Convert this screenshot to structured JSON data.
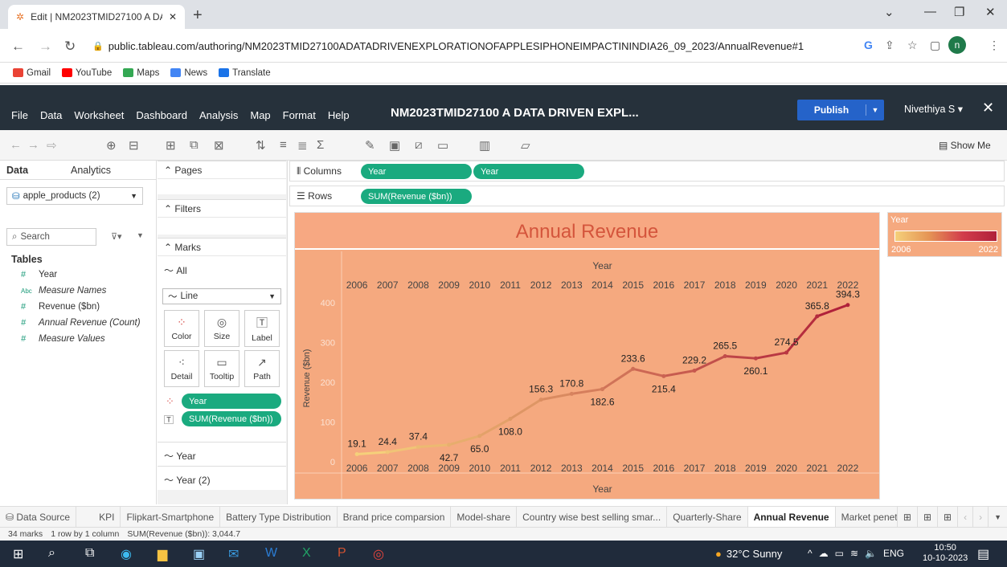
{
  "browser": {
    "tab_title": "Edit | NM2023TMID27100 A DAT",
    "url": "public.tableau.com/authoring/NM2023TMID27100ADATADRIVENEXPLORATIONOFAPPLESIPHONEIMPACTININDIA26_09_2023/AnnualRevenue#1",
    "profile_initial": "n",
    "bookmarks": [
      "Gmail",
      "YouTube",
      "Maps",
      "News",
      "Translate"
    ]
  },
  "tableau": {
    "menus": [
      "File",
      "Data",
      "Worksheet",
      "Dashboard",
      "Analysis",
      "Map",
      "Format",
      "Help"
    ],
    "workbook_title": "NM2023TMID27100 A DATA DRIVEN EXPL...",
    "publish_label": "Publish",
    "user_name": "Nivethiya S ▾",
    "show_me": "Show Me"
  },
  "data_pane": {
    "tabs": [
      "Data",
      "Analytics"
    ],
    "datasource": "apple_products (2)",
    "search_placeholder": "Search",
    "tables_header": "Tables",
    "fields": [
      {
        "icon": "#",
        "name": "Year"
      },
      {
        "icon": "Abc",
        "name": "Measure Names"
      },
      {
        "icon": "#",
        "name": "Revenue ($bn)"
      },
      {
        "icon": "#",
        "name": "Annual Revenue (Count)"
      },
      {
        "icon": "#",
        "name": "Measure Values"
      }
    ]
  },
  "cards": {
    "pages": "Pages",
    "filters": "Filters",
    "marks": "Marks",
    "all": "All",
    "mark_type": "Line",
    "mark_buttons": [
      "Color",
      "Size",
      "Label",
      "Detail",
      "Tooltip",
      "Path"
    ],
    "mark_pills": [
      "Year",
      "SUM(Revenue ($bn))"
    ],
    "sub_cards": [
      "Year",
      "Year (2)"
    ]
  },
  "shelves": {
    "columns_label": "Columns",
    "columns_pills": [
      "Year",
      "Year"
    ],
    "rows_label": "Rows",
    "rows_pills": [
      "SUM(Revenue ($bn))"
    ]
  },
  "chart_data": {
    "type": "line",
    "title": "Annual Revenue",
    "xlabel": "Year",
    "ylabel": "Revenue ($bn)",
    "x": [
      2006,
      2007,
      2008,
      2009,
      2010,
      2011,
      2012,
      2013,
      2014,
      2015,
      2016,
      2017,
      2018,
      2019,
      2020,
      2021,
      2022
    ],
    "values": [
      19.1,
      24.4,
      37.4,
      42.7,
      65.0,
      108.0,
      156.3,
      170.8,
      182.6,
      233.6,
      215.4,
      229.2,
      265.5,
      260.1,
      274.5,
      365.8,
      394.3
    ],
    "data_labels": [
      "19.1",
      "24.4",
      "37.4",
      "42.7",
      "65.0",
      "108.0",
      "156.3",
      "170.8",
      "182.6",
      "233.6",
      "215.4",
      "229.2",
      "265.5",
      "260.1",
      "274.5",
      "365.8",
      "394.3"
    ],
    "yticks": [
      0,
      100,
      200,
      300,
      400
    ],
    "ylim": [
      0,
      420
    ],
    "grid": false,
    "color_legend": {
      "title": "Year",
      "min": "2006",
      "max": "2022",
      "colors": [
        "#f5d07a",
        "#b0213a"
      ]
    }
  },
  "sheet_tabs": [
    "Data Source",
    "KPI",
    "Flipkart-Smartphone",
    "Battery Type Distribution",
    "Brand price comparsion",
    "Model-share",
    "Country wise best selling smar...",
    "Quarterly-Share",
    "Annual Revenue",
    "Market penetrati"
  ],
  "active_sheet": "Annual Revenue",
  "status": [
    "34 marks",
    "1 row by 1 column",
    "SUM(Revenue ($bn)): 3,044.7"
  ],
  "taskbar": {
    "weather": "32°C  Sunny",
    "lang": "ENG",
    "time": "10:50",
    "date": "10-10-2023"
  }
}
